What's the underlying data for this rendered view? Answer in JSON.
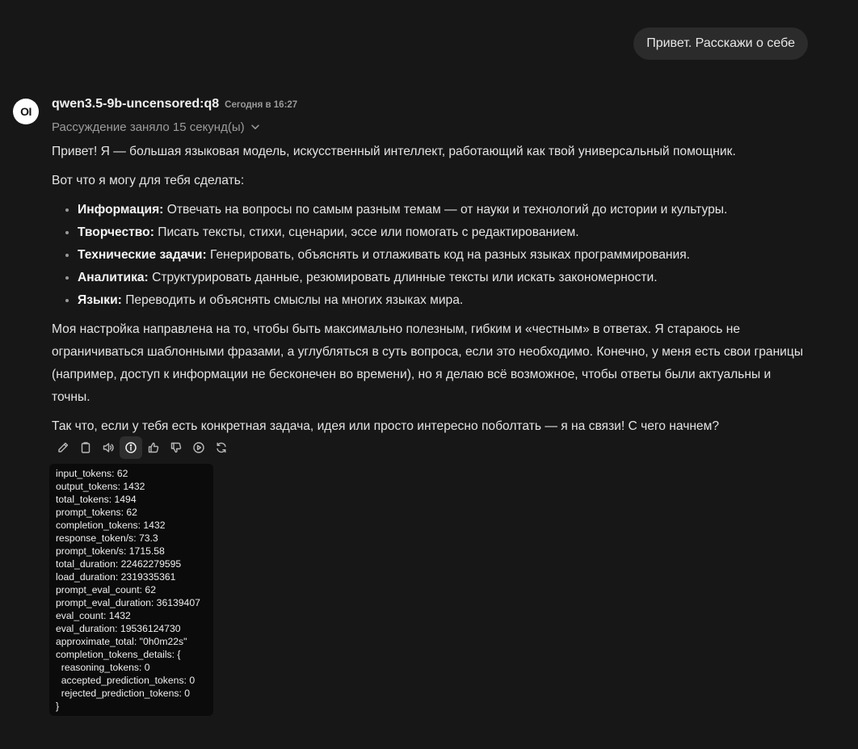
{
  "user_message": "Привет. Расскажи о себе",
  "assistant": {
    "avatar_text": "OI",
    "model_name": "qwen3.5-9b-uncensored:q8",
    "timestamp": "Сегодня в 16:27",
    "reasoning_label": "Рассуждение заняло 15 секунд(ы)",
    "intro": "Привет! Я — большая языковая модель, искусственный интеллект, работающий как твой универсальный помощник.",
    "lead": "Вот что я могу для тебя сделать:",
    "list": [
      {
        "title": "Информация:",
        "text": " Отвечать на вопросы по самым разным темам — от науки и технологий до истории и культуры."
      },
      {
        "title": "Творчество:",
        "text": " Писать тексты, стихи, сценарии, эссе или помогать с редактированием."
      },
      {
        "title": "Технические задачи:",
        "text": " Генерировать, объяснять и отлаживать код на разных языках программирования."
      },
      {
        "title": "Аналитика:",
        "text": " Структурировать данные, резюмировать длинные тексты или искать закономерности."
      },
      {
        "title": "Языки:",
        "text": " Переводить и объяснять смыслы на многих языках мира."
      }
    ],
    "paragraph2": "Моя настройка направлена на то, чтобы быть максимально полезным, гибким и «честным» в ответах. Я стараюсь не ограничиваться шаблонными фразами, а углубляться в суть вопроса, если это необходимо. Конечно, у меня есть свои границы (например, доступ к информации не бесконечен во времени), но я делаю всё возможное, чтобы ответы были актуальны и точны.",
    "paragraph3": "Так что, если у тебя есть конкретная задача, идея или просто интересно поболтать — я на связи! С чего начнем?"
  },
  "action_icons": [
    "edit-icon",
    "copy-icon",
    "speaker-icon",
    "info-icon",
    "thumbs-up-icon",
    "thumbs-down-icon",
    "play-icon",
    "regenerate-icon"
  ],
  "usage_info": "input_tokens: 62\noutput_tokens: 1432\ntotal_tokens: 1494\nprompt_tokens: 62\ncompletion_tokens: 1432\nresponse_token/s: 73.3\nprompt_token/s: 1715.58\ntotal_duration: 22462279595\nload_duration: 2319335361\nprompt_eval_count: 62\nprompt_eval_duration: 36139407\neval_count: 1432\neval_duration: 19536124730\napproximate_total: \"0h0m22s\"\ncompletion_tokens_details: {\n  reasoning_tokens: 0\n  accepted_prediction_tokens: 0\n  rejected_prediction_tokens: 0\n}"
}
